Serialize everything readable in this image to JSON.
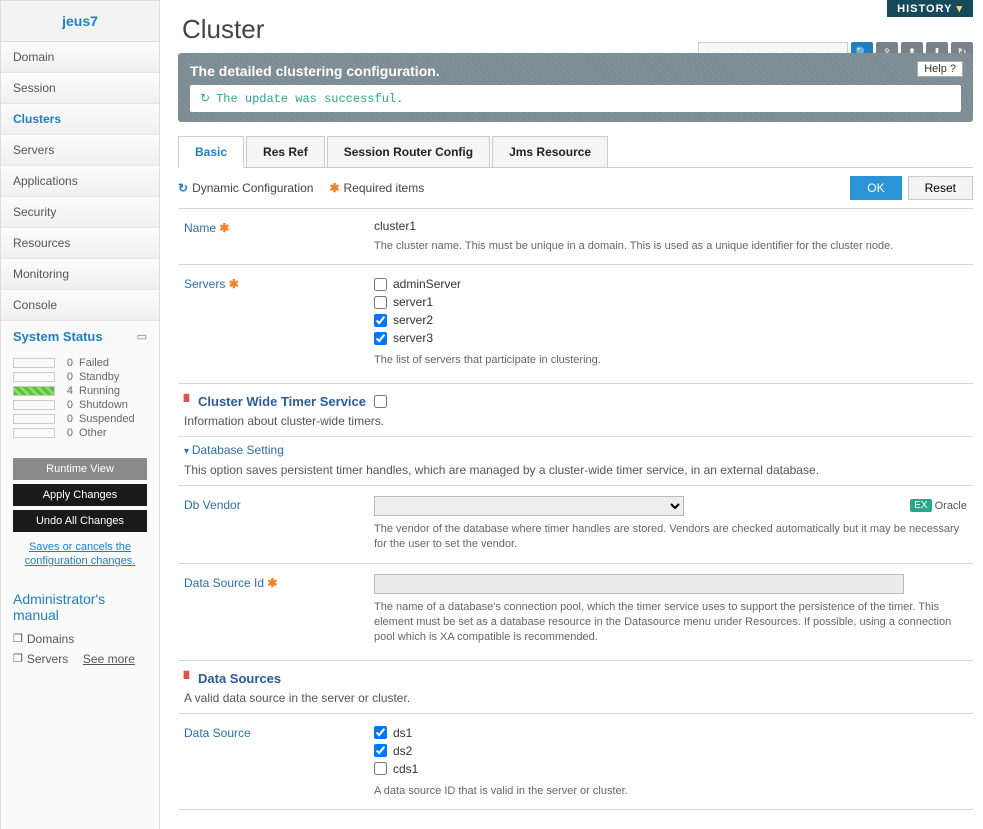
{
  "sidebar": {
    "brand": "jeus7",
    "items": [
      "Domain",
      "Session",
      "Clusters",
      "Servers",
      "Applications",
      "Security",
      "Resources",
      "Monitoring",
      "Console"
    ],
    "activeIndex": 2
  },
  "systemStatus": {
    "heading": "System Status",
    "rows": [
      {
        "count": "0",
        "label": "Failed",
        "running": false
      },
      {
        "count": "0",
        "label": "Standby",
        "running": false
      },
      {
        "count": "4",
        "label": "Running",
        "running": true
      },
      {
        "count": "0",
        "label": "Shutdown",
        "running": false
      },
      {
        "count": "0",
        "label": "Suspended",
        "running": false
      },
      {
        "count": "0",
        "label": "Other",
        "running": false
      }
    ]
  },
  "sideActions": {
    "runtime": "Runtime View",
    "apply": "Apply Changes",
    "undo": "Undo All Changes",
    "note": "Saves or cancels the configuration changes."
  },
  "manual": {
    "heading": "Administrator's manual",
    "items": [
      "Domains",
      "Servers"
    ],
    "seeMore": "See more"
  },
  "header": {
    "history": "HISTORY",
    "title": "Cluster"
  },
  "banner": {
    "title": "The detailed clustering configuration.",
    "msg": "The update was successful.",
    "help": "Help"
  },
  "tabs": [
    "Basic",
    "Res Ref",
    "Session Router Config",
    "Jms Resource"
  ],
  "legend": {
    "dyn": "Dynamic Configuration",
    "req": "Required items",
    "ok": "OK",
    "reset": "Reset"
  },
  "form": {
    "name": {
      "label": "Name",
      "value": "cluster1",
      "desc": "The cluster name. This must be unique in a domain. This is used as a unique identifier for the cluster node."
    },
    "servers": {
      "label": "Servers",
      "options": [
        {
          "label": "adminServer",
          "checked": false
        },
        {
          "label": "server1",
          "checked": false
        },
        {
          "label": "server2",
          "checked": true
        },
        {
          "label": "server3",
          "checked": true
        }
      ],
      "desc": "The list of servers that participate in clustering."
    },
    "timer": {
      "heading": "Cluster Wide Timer Service",
      "desc": "Information about cluster-wide timers."
    },
    "db": {
      "heading": "Database Setting",
      "desc": "This option saves persistent timer handles, which are managed by a cluster-wide timer service, in an external database.",
      "vendorLabel": "Db Vendor",
      "vendorDesc": "The vendor of the database where timer handles are stored. Vendors are checked automatically but it may be necessary for the user to set the vendor.",
      "vendorEx": "Oracle",
      "exBadge": "EX",
      "dsIdLabel": "Data Source Id",
      "dsIdDesc": "The name of a database's connection pool, which the timer service uses to support the persistence of the timer. This element must be set as a database resource in the Datasource menu under Resources. If possible, using a connection pool which is XA compatible is recommended."
    },
    "dataSources": {
      "heading": "Data Sources",
      "desc": "A valid data source in the server or cluster.",
      "label": "Data Source",
      "options": [
        {
          "label": "ds1",
          "checked": true
        },
        {
          "label": "ds2",
          "checked": true
        },
        {
          "label": "cds1",
          "checked": false
        }
      ],
      "itemDesc": "A data source ID that is valid in the server or cluster."
    }
  }
}
